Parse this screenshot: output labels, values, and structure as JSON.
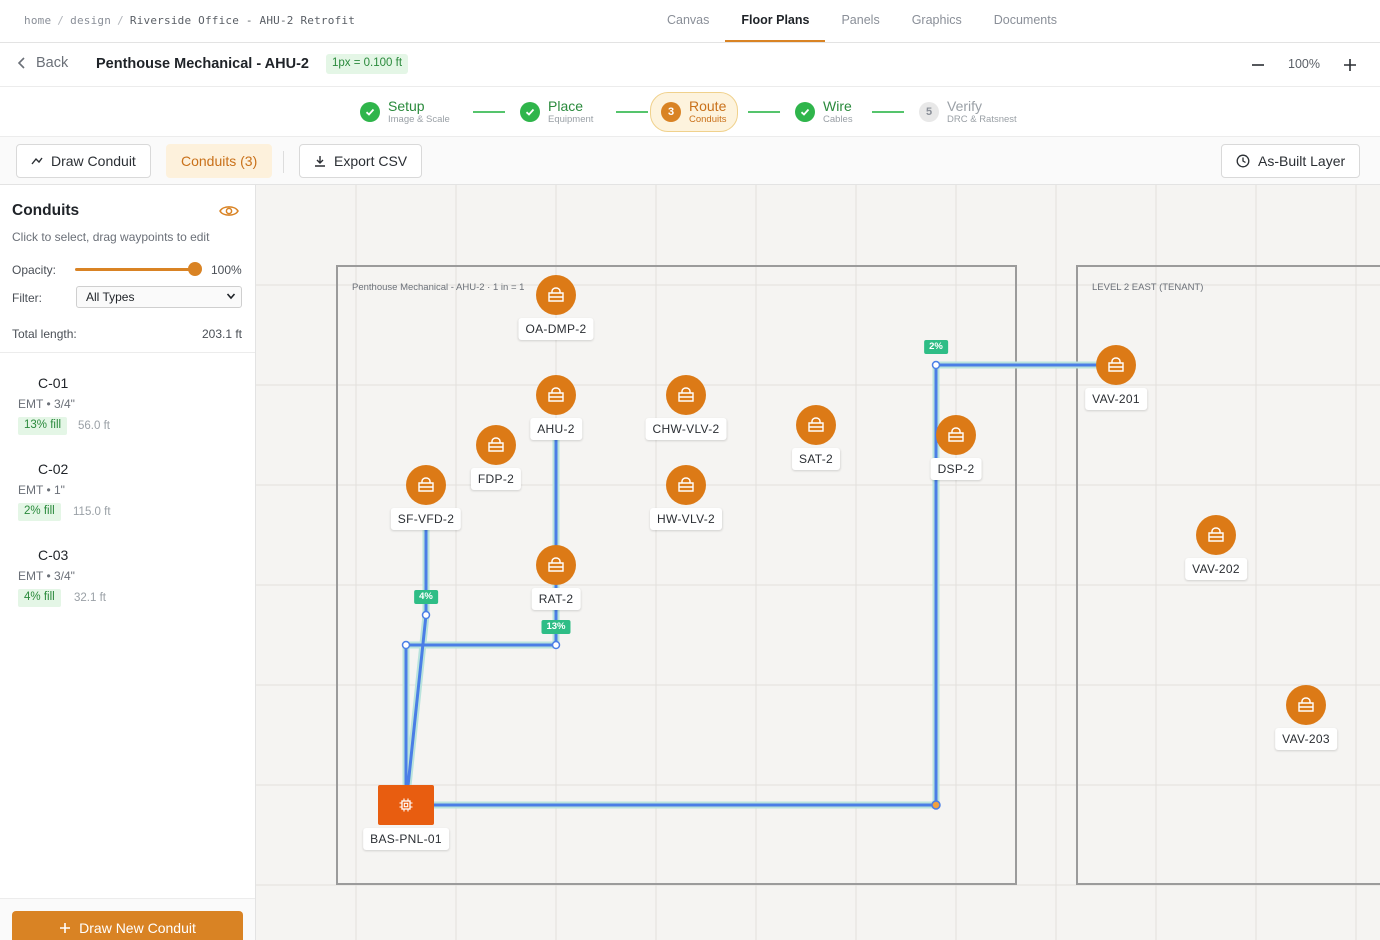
{
  "breadcrumb": {
    "home": "home",
    "design": "design",
    "project": "Riverside Office - AHU-2 Retrofit",
    "sep": "/"
  },
  "nav": {
    "tabs": [
      "Canvas",
      "Floor Plans",
      "Panels",
      "Graphics",
      "Documents"
    ],
    "active": "Floor Plans"
  },
  "titlebar": {
    "back": "Back",
    "title": "Penthouse Mechanical - AHU-2",
    "scale": "1px = 0.100 ft",
    "zoom": "100%"
  },
  "steps": [
    {
      "label": "Setup",
      "sub": "Image & Scale",
      "state": "done"
    },
    {
      "label": "Place",
      "sub": "Equipment",
      "state": "done"
    },
    {
      "num": "3",
      "label": "Route",
      "sub": "Conduits",
      "state": "active"
    },
    {
      "label": "Wire",
      "sub": "Cables",
      "state": "done"
    },
    {
      "num": "5",
      "label": "Verify",
      "sub": "DRC & Ratsnest",
      "state": "todo"
    }
  ],
  "toolbar": {
    "draw": "Draw Conduit",
    "conduits": "Conduits (3)",
    "export": "Export CSV",
    "asbuilt": "As-Built Layer"
  },
  "sidebar": {
    "title": "Conduits",
    "subtitle": "Click to select, drag waypoints to edit",
    "opacity_label": "Opacity:",
    "opacity_value": "100%",
    "opacity": 1.0,
    "filter_label": "Filter:",
    "filter_value": "All Types",
    "total_label": "Total length:",
    "total_value": "203.1 ft",
    "conduits": [
      {
        "id": "C-01",
        "spec": "EMT • 3/4\"",
        "fill": "13% fill",
        "length": "56.0 ft"
      },
      {
        "id": "C-02",
        "spec": "EMT • 1\"",
        "fill": "2% fill",
        "length": "115.0 ft"
      },
      {
        "id": "C-03",
        "spec": "EMT • 3/4\"",
        "fill": "4% fill",
        "length": "32.1 ft"
      }
    ],
    "draw_new": "Draw New Conduit"
  },
  "canvas": {
    "rooms": [
      {
        "label": "Penthouse Mechanical - AHU-2 · 1 in = 1"
      },
      {
        "label": "LEVEL 2 EAST (TENANT)"
      }
    ],
    "devices": [
      "OA-DMP-2",
      "AHU-2",
      "CHW-VLV-2",
      "FDP-2",
      "SAT-2",
      "DSP-2",
      "SF-VFD-2",
      "HW-VLV-2",
      "RAT-2",
      "VAV-201",
      "VAV-202",
      "VAV-203"
    ],
    "panel": "BAS-PNL-01",
    "fill_badges": [
      "4%",
      "13%",
      "2%"
    ]
  },
  "colors": {
    "accent": "#d98324",
    "device": "#dc7a16",
    "panel": "#e85d10",
    "conduit": "#4a7ee6",
    "badge": "#2ebd86",
    "success": "#2fb54b"
  }
}
